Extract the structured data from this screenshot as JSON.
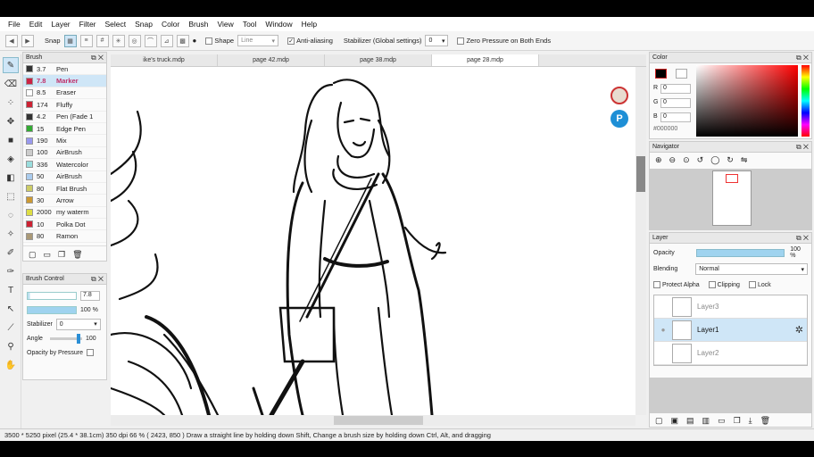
{
  "menu": [
    "File",
    "Edit",
    "Layer",
    "Filter",
    "Select",
    "Snap",
    "Color",
    "Brush",
    "View",
    "Tool",
    "Window",
    "Help"
  ],
  "toolbar": {
    "snap_label": "Snap",
    "shape_label": "Shape",
    "shape_value": "Line",
    "antialias_label": "Anti-aliasing",
    "stabilizer_label": "Stabilizer (Global settings)",
    "stabilizer_value": "0",
    "zero_pressure_label": "Zero Pressure on Both Ends"
  },
  "brush_panel": {
    "title": "Brush",
    "items": [
      {
        "size": "3.7",
        "name": "Pen",
        "color": "#333333"
      },
      {
        "size": "7.8",
        "name": "Marker",
        "color": "#cc2244",
        "selected": true
      },
      {
        "size": "8.5",
        "name": "Eraser",
        "color": "#ffffff"
      },
      {
        "size": "174",
        "name": "Fluffy",
        "color": "#cc2233"
      },
      {
        "size": "4.2",
        "name": "Pen (Fade 1",
        "color": "#333333"
      },
      {
        "size": "15",
        "name": "Edge Pen",
        "color": "#33aa33"
      },
      {
        "size": "190",
        "name": "Mix",
        "color": "#9999ee"
      },
      {
        "size": "100",
        "name": "AirBrush",
        "color": "#cccccc"
      },
      {
        "size": "336",
        "name": "Watercolor",
        "color": "#99dddd"
      },
      {
        "size": "50",
        "name": "AirBrush",
        "color": "#aaccee"
      },
      {
        "size": "80",
        "name": "Flat Brush",
        "color": "#cccc66"
      },
      {
        "size": "30",
        "name": "Arrow",
        "color": "#cc9933"
      },
      {
        "size": "2000",
        "name": "my waterm",
        "color": "#dddd44"
      },
      {
        "size": "10",
        "name": "Polka Dot",
        "color": "#cc2233"
      },
      {
        "size": "80",
        "name": "Ramon",
        "color": "#aa9977"
      }
    ]
  },
  "brush_control": {
    "title": "Brush Control",
    "size_value": "7.8",
    "opacity_value": "100 %",
    "stabilizer_label": "Stabilizer",
    "stabilizer_value": "0",
    "angle_label": "Angle",
    "angle_value": "100",
    "opacity_pressure_label": "Opacity by Pressure"
  },
  "tabs": [
    {
      "label": "ike's truck.mdp",
      "active": false
    },
    {
      "label": "page 42.mdp",
      "active": false
    },
    {
      "label": "page 38.mdp",
      "active": false
    },
    {
      "label": "page 28.mdp",
      "active": true
    }
  ],
  "color_panel": {
    "title": "Color",
    "r_label": "R",
    "r_value": "0",
    "g_label": "G",
    "g_value": "0",
    "b_label": "B",
    "b_value": "0",
    "hex": "#000000",
    "hue_color": "#ff0000"
  },
  "navigator": {
    "title": "Navigator"
  },
  "layer_panel": {
    "title": "Layer",
    "opacity_label": "Opacity",
    "opacity_value": "100 %",
    "blending_label": "Blending",
    "blending_value": "Normal",
    "protect_alpha_label": "Protect Alpha",
    "clipping_label": "Clipping",
    "lock_label": "Lock",
    "layers": [
      {
        "name": "Layer3",
        "selected": false
      },
      {
        "name": "Layer1",
        "selected": true
      },
      {
        "name": "Layer2",
        "selected": false
      }
    ]
  },
  "status": {
    "text": "3500 * 5250 pixel  (25.4 * 38.1cm)  350 dpi  66 %  ( 2423, 850 )  Draw a straight line by holding down Shift, Change a brush size by holding down Ctrl, Alt, and dragging"
  }
}
